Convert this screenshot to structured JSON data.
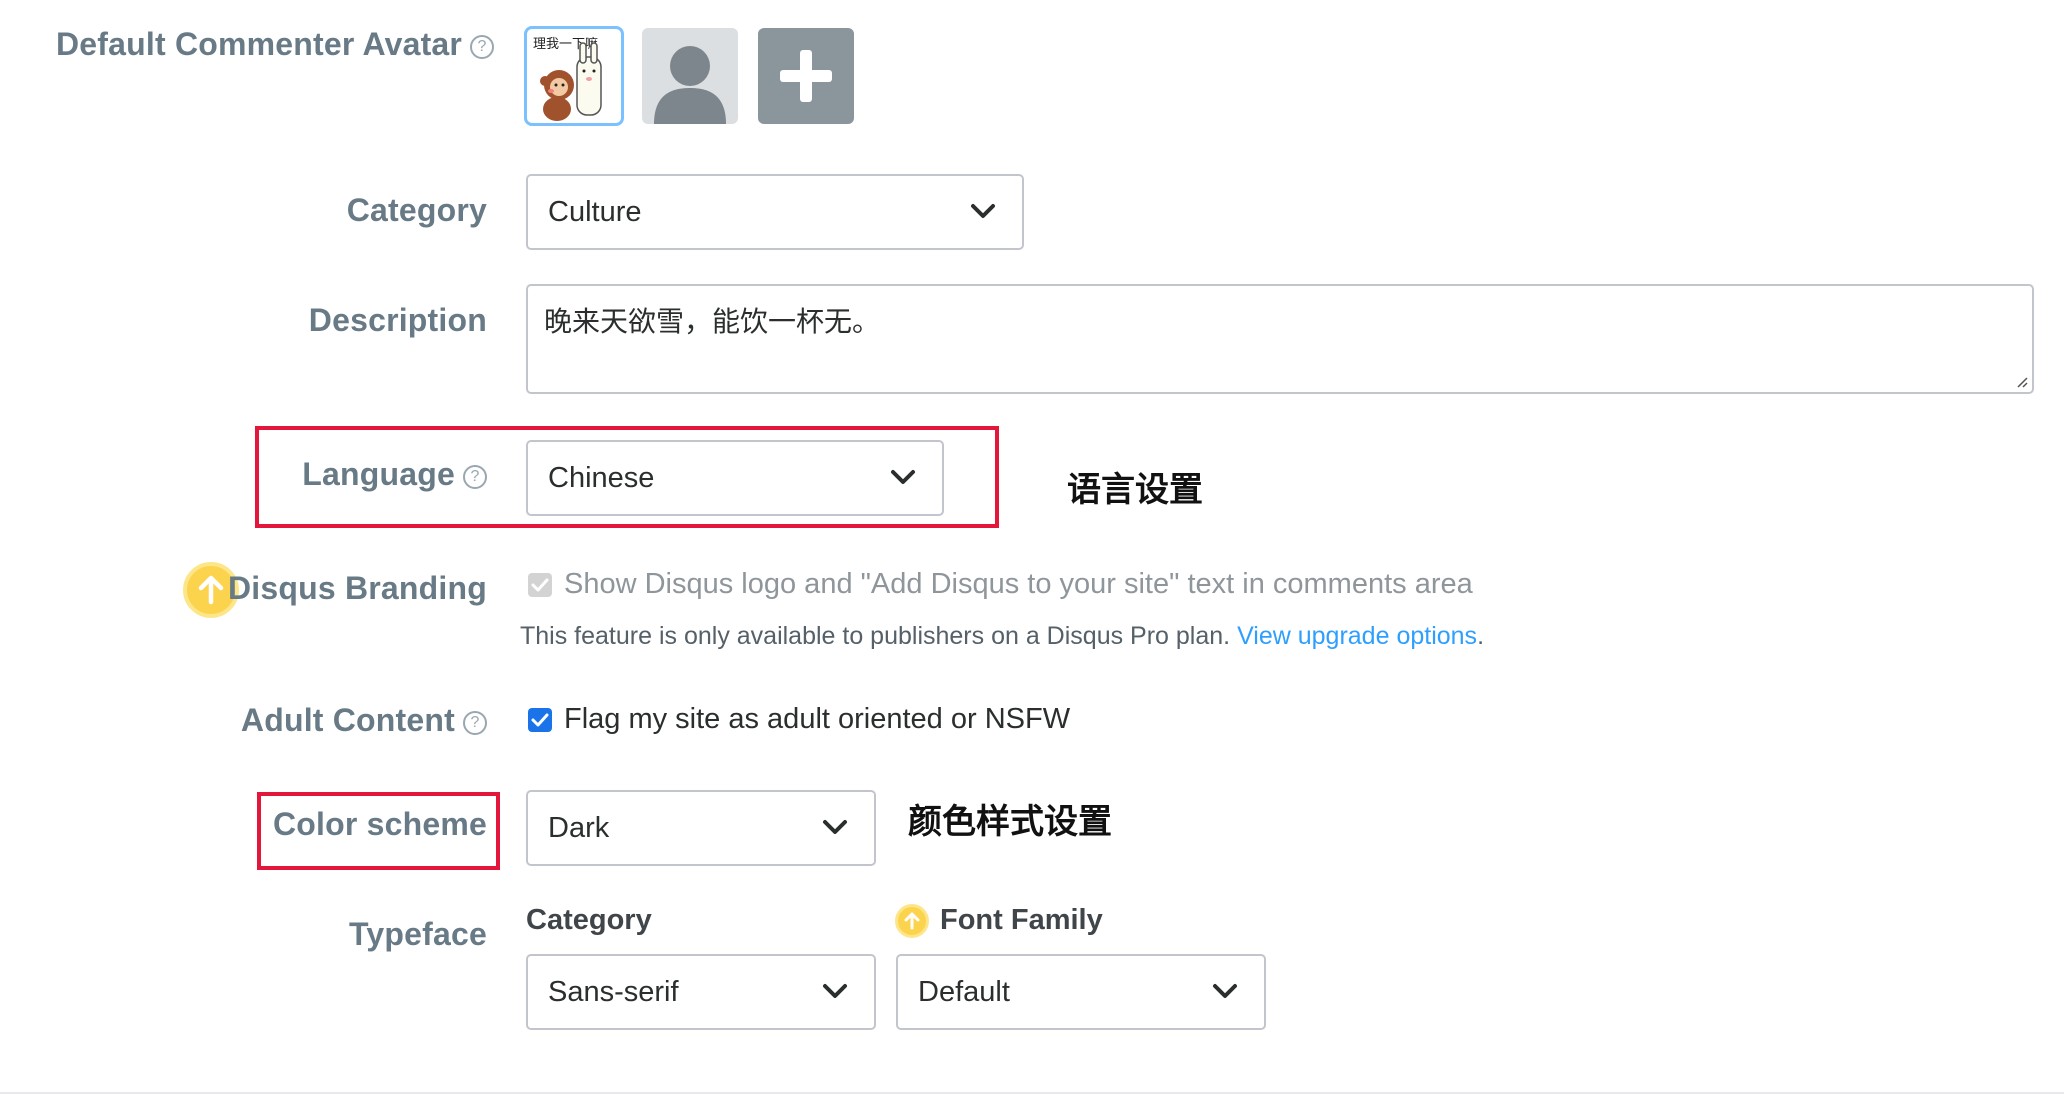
{
  "avatar": {
    "label": "Default Commenter Avatar",
    "help": "?",
    "custom_image_text": "理我一下嘛",
    "selected_index": 0
  },
  "category": {
    "label": "Category",
    "value": "Culture"
  },
  "description": {
    "label": "Description",
    "value": "晚来天欲雪，能饮一杯无。"
  },
  "language": {
    "label": "Language",
    "help": "?",
    "value": "Chinese",
    "annotation": "语言设置"
  },
  "branding": {
    "label": "Disqus Branding",
    "checkbox_text": "Show Disqus logo and \"Add Disqus to your site\" text in comments area",
    "checked": true,
    "disabled": true,
    "note": "This feature is only available to publishers on a Disqus Pro plan.",
    "note_link": "View upgrade options",
    "note_end": "."
  },
  "adult": {
    "label": "Adult Content",
    "help": "?",
    "checkbox_text": "Flag my site as adult oriented or NSFW",
    "checked": true
  },
  "color_scheme": {
    "label": "Color scheme",
    "value": "Dark",
    "annotation": "颜色样式设置"
  },
  "typeface": {
    "label": "Typeface",
    "category_label": "Category",
    "category_value": "Sans-serif",
    "font_family_label": "Font Family",
    "font_family_value": "Default"
  },
  "colors": {
    "accent": "#2e9fff",
    "annotation_box": "#e3163c",
    "upgrade": "#fcd34d",
    "checkbox": "#1a73e8"
  }
}
